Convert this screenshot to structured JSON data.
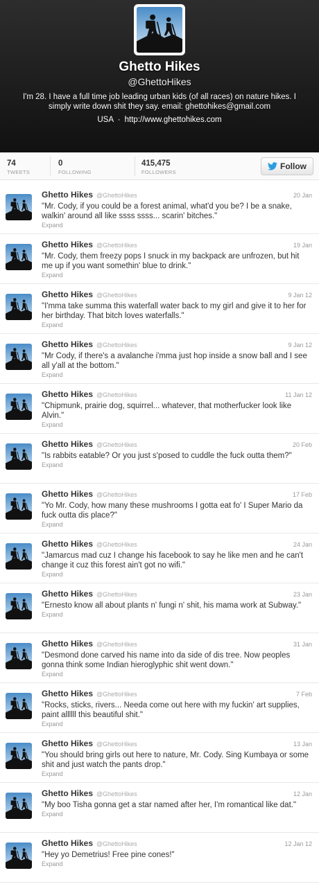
{
  "profile": {
    "name": "Ghetto Hikes",
    "handle": "@GhettoHikes",
    "bio": "I'm 28. I have a full time job leading urban kids (of all races) on nature hikes. I simply write down shit they say. email: ghettohikes@gmail.com",
    "location": "USA",
    "separator": "·",
    "url": "http://www.ghettohikes.com"
  },
  "stats": {
    "tweets": {
      "value": "74",
      "label": "TWEETS"
    },
    "following": {
      "value": "0",
      "label": "FOLLOWING"
    },
    "followers": {
      "value": "415,475",
      "label": "FOLLOWERS"
    }
  },
  "follow_button": {
    "label": "Follow",
    "icon": "twitter-bird-icon"
  },
  "colors": {
    "accent": "#2b9de1",
    "header_bg": "#1a1a1a"
  },
  "tweets": [
    {
      "name": "Ghetto Hikes",
      "handle": "@GhettoHikes",
      "date": "20 Jan",
      "text": "\"Mr. Cody, if you could be a forest animal, what'd you be? I be a snake, walkin' around all like ssss ssss... scarin' bitches.\"",
      "expand": "Expand"
    },
    {
      "name": "Ghetto Hikes",
      "handle": "@GhettoHikes",
      "date": "19 Jan",
      "text": "\"Mr. Cody, them freezy pops I snuck in my backpack are unfrozen, but hit me up if you want somethin' blue to drink.\"",
      "expand": "Expand"
    },
    {
      "name": "Ghetto Hikes",
      "handle": "@GhettoHikes",
      "date": "9 Jan 12",
      "text": "\"I'mma take summa this waterfall water back to my girl and give it to her for her birthday. That bitch loves waterfalls.\"",
      "expand": "Expand"
    },
    {
      "name": "Ghetto Hikes",
      "handle": "@GhettoHikes",
      "date": "9 Jan 12",
      "text": "\"Mr Cody, if there's a avalanche i'mma just hop inside a snow ball and I see all y'all at the bottom.\"",
      "expand": "Expand"
    },
    {
      "name": "Ghetto Hikes",
      "handle": "@GhettoHikes",
      "date": "11 Jan 12",
      "text": "\"Chipmunk, prairie dog, squirrel... whatever, that motherfucker look like Alvin.\"",
      "expand": "Expand"
    },
    {
      "name": "Ghetto Hikes",
      "handle": "@GhettoHikes",
      "date": "20 Feb",
      "text": "\"Is rabbits eatable? Or you just s'posed to cuddle the fuck outta them?\"",
      "expand": "Expand"
    },
    {
      "name": "Ghetto Hikes",
      "handle": "@GhettoHikes",
      "date": "17 Feb",
      "text": "\"Yo Mr. Cody, how many these mushrooms I gotta eat fo' I Super Mario da fuck outta dis place?\"",
      "expand": "Expand"
    },
    {
      "name": "Ghetto Hikes",
      "handle": "@GhettoHikes",
      "date": "24 Jan",
      "text": "\"Jamarcus mad cuz I change his facebook to say he like men and he can't change it cuz this forest ain't got no wifi.\"",
      "expand": "Expand"
    },
    {
      "name": "Ghetto Hikes",
      "handle": "@GhettoHikes",
      "date": "23 Jan",
      "text": "\"Ernesto know all about plants n' fungi n' shit, his mama work at Subway.\"",
      "expand": "Expand"
    },
    {
      "name": "Ghetto Hikes",
      "handle": "@GhettoHikes",
      "date": "31 Jan",
      "text": "\"Desmond done carved his name into da side of dis tree. Now peoples gonna think some Indian hieroglyphic shit went down.\"",
      "expand": "Expand"
    },
    {
      "name": "Ghetto Hikes",
      "handle": "@GhettoHikes",
      "date": "7 Feb",
      "text": "\"Rocks, sticks, rivers... Needa come out here with my fuckin' art supplies, paint allllll this beautiful shit.\"",
      "expand": "Expand"
    },
    {
      "name": "Ghetto Hikes",
      "handle": "@GhettoHikes",
      "date": "13 Jan",
      "text": "\"You should bring girls out here to nature, Mr. Cody. Sing Kumbaya or some shit and just watch the pants drop.\"",
      "expand": "Expand"
    },
    {
      "name": "Ghetto Hikes",
      "handle": "@GhettoHikes",
      "date": "12 Jan",
      "text": "\"My boo Tisha gonna get a star named after her, I'm romantical like dat.\"",
      "expand": "Expand"
    },
    {
      "name": "Ghetto Hikes",
      "handle": "@GhettoHikes",
      "date": "12 Jan 12",
      "text": "\"Hey yo Demetrius! Free pine cones!\"",
      "expand": "Expand"
    }
  ]
}
